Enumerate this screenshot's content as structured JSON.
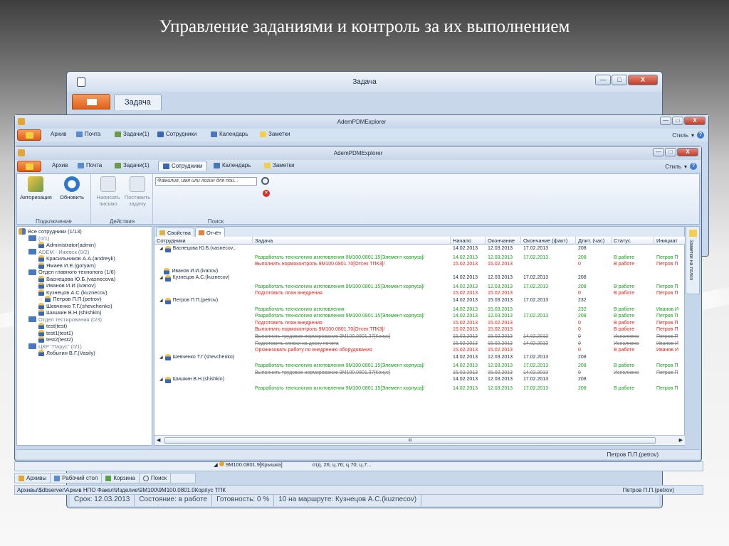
{
  "slide": {
    "title": "Управление заданиями и контроль за их выполнением"
  },
  "task_window": {
    "title": "Задача",
    "tab": "Задача",
    "footer": [
      "Срок: 12.03.2013",
      "Состояние: в работе",
      "Готовность: 0 %",
      "10 на маршруте: Кузнецов А.С.(kuznecov)"
    ],
    "buttons": {
      "minimize": "—",
      "maximize": "□",
      "close": "X"
    }
  },
  "mid_window": {
    "title": "AdemPDMExplorer",
    "tabs": [
      "Архив",
      "Почта",
      "Задачи(1)",
      "Сотрудники",
      "Календарь",
      "Заметки"
    ],
    "style_label": "Стиль",
    "bottom": {
      "tree_row": "9M100.0801.9[Крышка]",
      "tree_row_extra": "отд. 26; ц.76; ц.70; ц.7...",
      "tabs": [
        "Архивы",
        "Рабочий стол",
        "Корзина",
        "Поиск"
      ],
      "status_path": "Архивы\\$dbserver\\Архив НПО Факел\\Изделие\\9M100\\9M100.0801.0Корпус ТПК",
      "status_user": "Петров П.П.(petrov)"
    }
  },
  "main_window": {
    "title": "AdemPDMExplorer",
    "tabs": [
      "Архив",
      "Почта",
      "Задачи(1)",
      "Сотрудники",
      "Календарь",
      "Заметки"
    ],
    "active_tab": "Сотрудники",
    "style_label": "Стиль",
    "help": "?",
    "ribbon": {
      "groups": [
        "Подключение",
        "Действия",
        "Поиск"
      ],
      "auth": "Авторизация",
      "refresh": "Обновить",
      "write_line1": "Написать",
      "write_line2": "письмо",
      "assign_line1": "Поставить",
      "assign_line2": "задачу",
      "search_placeholder": "Фамилия, имя или логин для пои..."
    },
    "tree": [
      {
        "label": "Все сотрудники (1/13)",
        "kind": "root",
        "depth": 0
      },
      {
        "label": "(0/1)",
        "kind": "dept",
        "depth": 1,
        "dim": true
      },
      {
        "label": "Administrator(admin)",
        "kind": "user",
        "depth": 2
      },
      {
        "label": "ADEM - Ижевск (0/2)",
        "kind": "dept",
        "depth": 1,
        "dim": true
      },
      {
        "label": "Красильников А.А.(andreyk)",
        "kind": "user",
        "depth": 2
      },
      {
        "label": "Ямаев И.Е.(goryam)",
        "kind": "user",
        "depth": 2
      },
      {
        "label": "Отдел главного технолога (1/6)",
        "kind": "dept",
        "depth": 1
      },
      {
        "label": "Васнецова Ю.Б.(vasnecova)",
        "kind": "user",
        "depth": 2
      },
      {
        "label": "Иванов И.И.(ivanov)",
        "kind": "user",
        "depth": 2
      },
      {
        "label": "Кузнецов А.С.(kuznecov)",
        "kind": "user",
        "depth": 2
      },
      {
        "label": "Петров П.П.(petrov)",
        "kind": "user",
        "depth": 2,
        "star": true
      },
      {
        "label": "Шевченко Т.Г.(shevchenko)",
        "kind": "user",
        "depth": 2
      },
      {
        "label": "Шишкин В.Н.(shishkin)",
        "kind": "user",
        "depth": 2
      },
      {
        "label": "Отдел тестирования (0/3)",
        "kind": "dept",
        "depth": 1,
        "dim": true
      },
      {
        "label": "test(test)",
        "kind": "user",
        "depth": 2
      },
      {
        "label": "test1(test1)",
        "kind": "user",
        "depth": 2
      },
      {
        "label": "test2(test2)",
        "kind": "user",
        "depth": 2
      },
      {
        "label": "ЦКР \"Парус\" (0/1)",
        "kind": "dept",
        "depth": 1,
        "dim": true
      },
      {
        "label": "Лобыгин В.Г.(Vasily)",
        "kind": "user",
        "depth": 2
      }
    ],
    "subtabs": [
      "Свойства",
      "Отчёт"
    ],
    "columns": [
      "Сотрудники",
      "Задача",
      "Начало",
      "Окончание",
      "Окончание (факт)",
      "Длит. (час)",
      "Статус",
      "Инициат"
    ],
    "rows": [
      {
        "type": "p",
        "emp": "Васнецова Ю.Б.(vasnecov...",
        "start": "14.02.2013",
        "end": "12.03.2013",
        "fact": "17.02.2013",
        "dur": "208"
      },
      {
        "type": "g",
        "task": "Разработать технологию изготовления 9M100.0801.15[Элемент корпуса]/",
        "start": "14.02.2013",
        "end": "12.03.2013",
        "fact": "17.02.2013",
        "dur": "208",
        "status": "В работе",
        "init": "Петров П"
      },
      {
        "type": "r",
        "task": "Выполнить нормоконтроль 9M100.0801.70[Отсек ТПК3]/",
        "start": "15.02.2013",
        "end": "15.02.2013",
        "fact": "",
        "dur": "0",
        "status": "В работе",
        "init": "Петров П"
      },
      {
        "type": "p",
        "emp": "Иванов И.И.(ivanov)",
        "start": "",
        "end": "",
        "fact": "",
        "dur": "",
        "noexp": true
      },
      {
        "type": "p",
        "emp": "Кузнецов А.С.(kuznecov)",
        "start": "14.02.2013",
        "end": "12.03.2013",
        "fact": "17.02.2013",
        "dur": "208"
      },
      {
        "type": "g",
        "task": "Разработать технологию изготовления 9M100.0801.15[Элемент корпуса]/",
        "start": "14.02.2013",
        "end": "12.03.2013",
        "fact": "17.02.2013",
        "dur": "208",
        "status": "В работе",
        "init": "Петров П"
      },
      {
        "type": "r",
        "task": "Подготовить план внедрения",
        "start": "15.02.2013",
        "end": "15.02.2013",
        "fact": "",
        "dur": "0",
        "status": "В работе",
        "init": "Петров П"
      },
      {
        "type": "p",
        "emp": "Петров П.П.(petrov)",
        "start": "14.02.2013",
        "end": "15.03.2013",
        "fact": "17.02.2013",
        "dur": "232"
      },
      {
        "type": "g",
        "task": "Разработать технологию изготовления",
        "start": "14.02.2013",
        "end": "15.03.2013",
        "fact": "",
        "dur": "232",
        "status": "В работе",
        "init": "Иванов И"
      },
      {
        "type": "g",
        "task": "Разработать технологию изготовления 9M100.0801.15[Элемент корпуса]/",
        "start": "14.02.2013",
        "end": "12.03.2013",
        "fact": "17.02.2013",
        "dur": "208",
        "status": "В работе",
        "init": "Петров П"
      },
      {
        "type": "r",
        "task": "Подготовить план внедрения",
        "start": "15.02.2013",
        "end": "15.02.2013",
        "fact": "",
        "dur": "0",
        "status": "В работе",
        "init": "Петров П"
      },
      {
        "type": "r",
        "task": "Выполнить нормоконтроль 9M100.0801.70[Отсек ТПК3]/",
        "start": "15.02.2013",
        "end": "15.02.2013",
        "fact": "",
        "dur": "0",
        "status": "В работе",
        "init": "Петров П"
      },
      {
        "type": "x",
        "task": "Выполнить трудовое нормирование 9M100.0801.37[Конус]",
        "start": "15.02.2013",
        "end": "15.02.2013",
        "fact": "14.02.2013",
        "dur": "0",
        "status": "Исполнено",
        "init": "Петров П"
      },
      {
        "type": "x",
        "task": "Подготовить списки на доску почета",
        "start": "15.02.2013",
        "end": "15.02.2013",
        "fact": "14.02.2013",
        "dur": "0",
        "status": "Исполнено",
        "init": "Иванов И"
      },
      {
        "type": "r",
        "task": "Организовать работу по внедрению оборудования",
        "start": "15.02.2013",
        "end": "15.02.2013",
        "fact": "",
        "dur": "0",
        "status": "В работе",
        "init": "Иванов И"
      },
      {
        "type": "p",
        "emp": "Шевченко Т.Г.(shevchenko)",
        "start": "14.02.2013",
        "end": "12.03.2013",
        "fact": "17.02.2013",
        "dur": "208"
      },
      {
        "type": "g",
        "task": "Разработать технологию изготовления 9M100.0801.15[Элемент корпуса]/",
        "start": "14.02.2013",
        "end": "12.03.2013",
        "fact": "17.02.2013",
        "dur": "208",
        "status": "В работе",
        "init": "Петров П"
      },
      {
        "type": "x",
        "task": "Выполнить трудовое нормирование 9M100.0801.37[Конус]",
        "start": "15.02.2013",
        "end": "15.02.2013",
        "fact": "14.02.2013",
        "dur": "0",
        "status": "Исполнено",
        "init": "Петров П"
      },
      {
        "type": "p",
        "emp": "Шишкин В.Н.(shishkin)",
        "start": "14.02.2013",
        "end": "12.03.2013",
        "fact": "17.02.2013",
        "dur": "208"
      },
      {
        "type": "g",
        "task": "Разработать технологию изготовления 9M100.0801.15[Элемент корпуса]/",
        "start": "14.02.2013",
        "end": "12.03.2013",
        "fact": "17.02.2013",
        "dur": "208",
        "status": "В работе",
        "init": "Петров П"
      }
    ],
    "scroll_thumb": "III",
    "side_tab": "Заметки на полях",
    "status_user": "Петров П.П.(petrov)"
  },
  "colors": {
    "accent_orange": "#e05f1a",
    "done_green": "#18a01c",
    "overdue_red": "#e3251e",
    "frame_blue": "#c5d6ea"
  }
}
